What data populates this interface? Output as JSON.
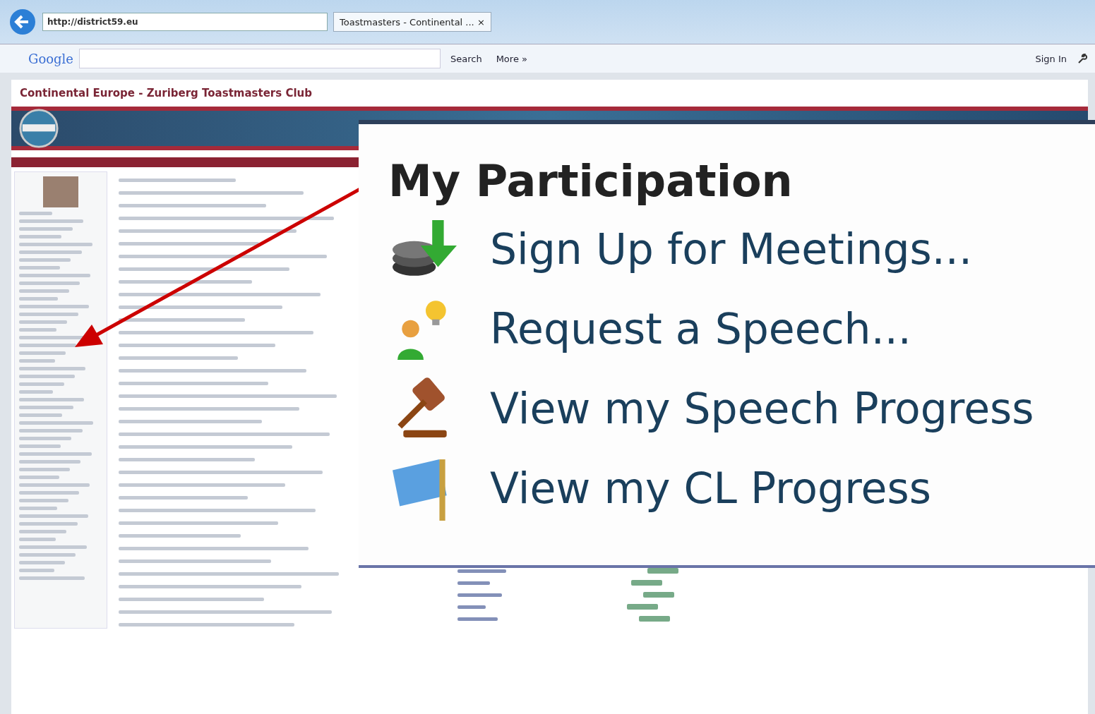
{
  "browser": {
    "url": "http://district59.eu",
    "tab_title": "Toastmasters - Continental ...",
    "tab_close": "×",
    "search_logo": "Google",
    "search_button": "Search",
    "more": "More »",
    "sign_in": "Sign In"
  },
  "site": {
    "title": "Continental Europe - Zuriberg Toastmasters Club"
  },
  "callout": {
    "title": "My Participation",
    "items": [
      {
        "kind": "signup",
        "label": "Sign Up for Meetings..."
      },
      {
        "kind": "request",
        "label": "Request a Speech..."
      },
      {
        "kind": "speech",
        "label": "View my Speech Progress"
      },
      {
        "kind": "cl",
        "label": "View my CL Progress"
      }
    ]
  }
}
